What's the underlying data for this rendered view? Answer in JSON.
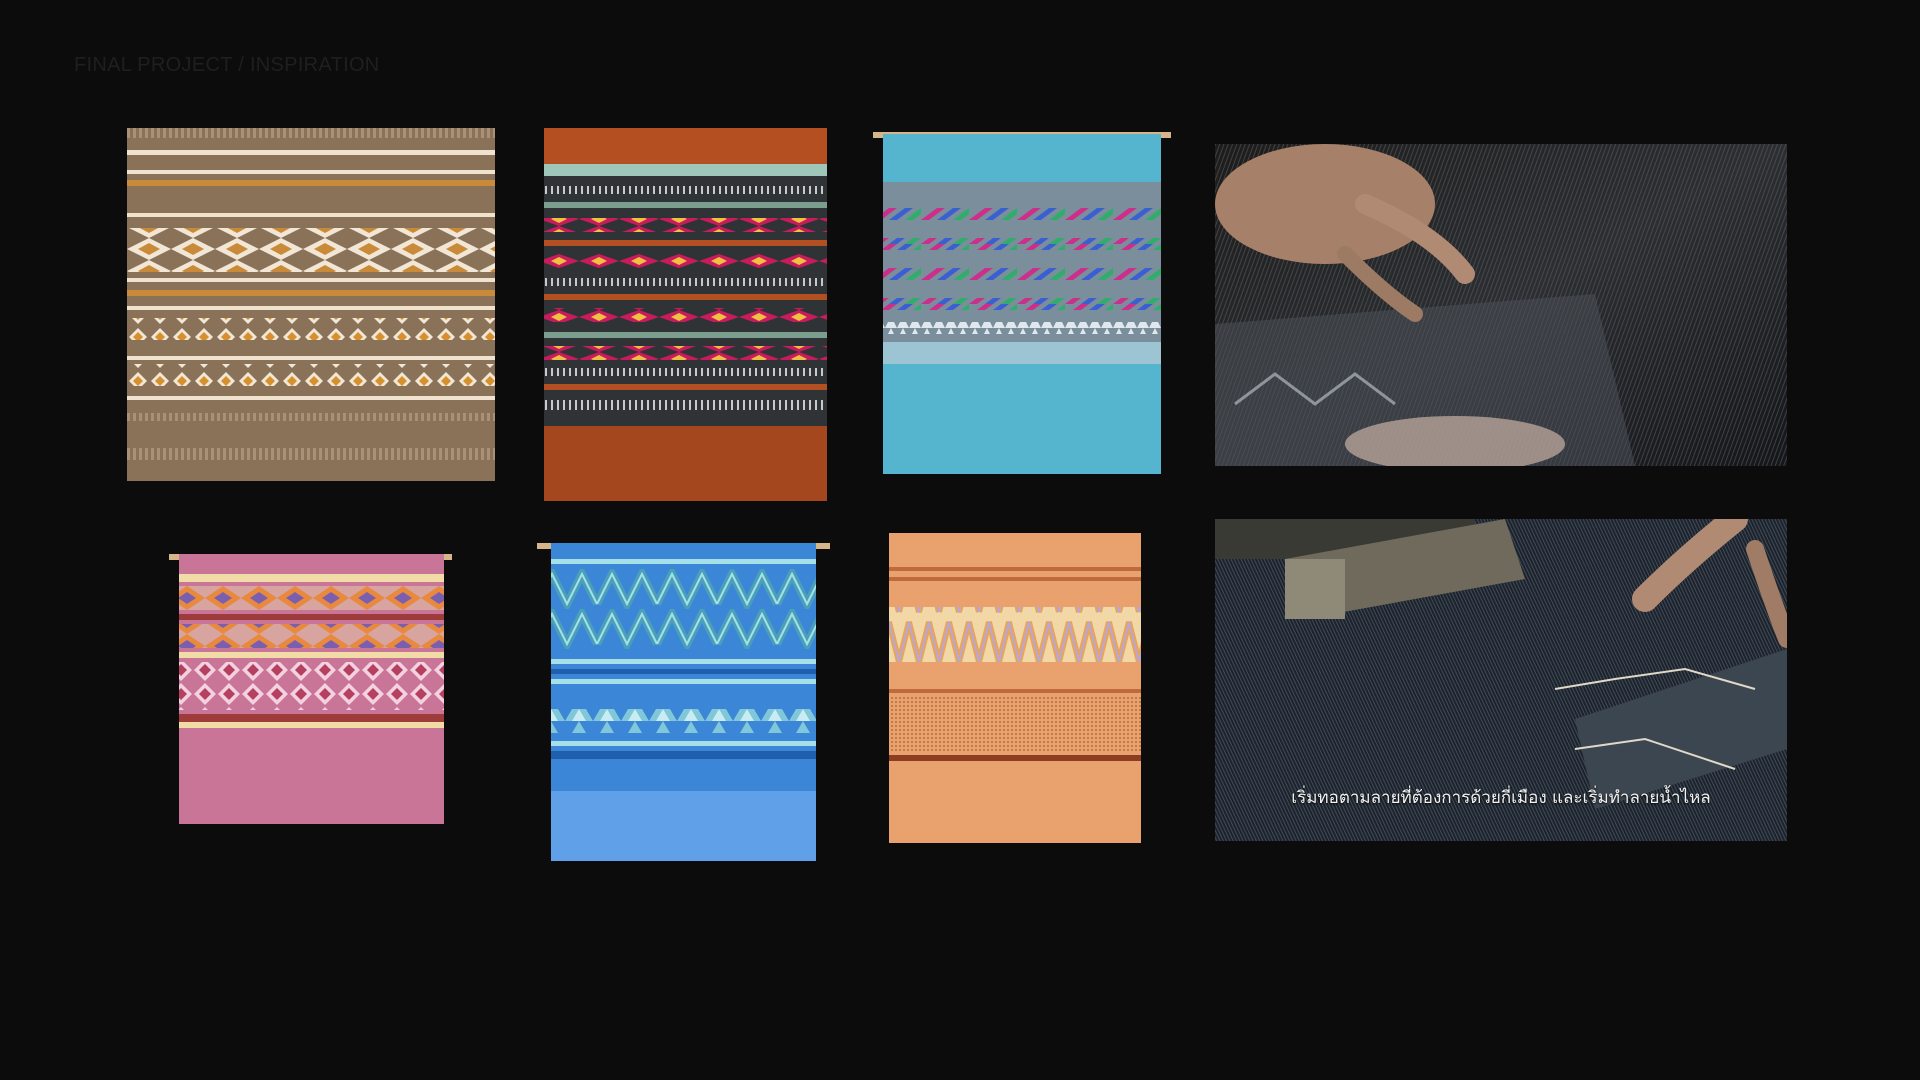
{
  "header": {
    "title": "FINAL PROJECT / INSPIRATION"
  },
  "gallery": {
    "images": [
      {
        "name": "textile-brown-geometric",
        "colors": {
          "base": "#8a7258",
          "pattern": "#f2e7d6",
          "accent": "#c98a3a"
        }
      },
      {
        "name": "textile-rust-dark-striped",
        "colors": {
          "base": "#a4471f",
          "pattern": "#2f3336",
          "accent": "#c81b5d"
        }
      },
      {
        "name": "textile-turquoise-striped",
        "colors": {
          "base": "#55b5cf",
          "pattern": "#7a8e9c",
          "accent": "#cc2f8a"
        }
      },
      {
        "name": "textile-pink-diamond",
        "colors": {
          "base": "#c97597",
          "pattern": "#e89a74",
          "accent": "#9e3c3c"
        }
      },
      {
        "name": "textile-blue-zigzag",
        "colors": {
          "base": "#3c86d8",
          "pattern": "#4aa0b8",
          "accent": "#a5e0e8"
        }
      },
      {
        "name": "textile-orange-ikat",
        "colors": {
          "base": "#e9a26e",
          "pattern": "#bf6a3c",
          "accent": "#f1d8a6"
        }
      }
    ],
    "videos": [
      {
        "name": "weaving-loom-closeup-1",
        "caption": ""
      },
      {
        "name": "weaving-loom-closeup-2",
        "caption": "เริ่มทอตามลายที่ต้องการด้วยกี่เมือง และเริ่มทำลายน้ำไหล"
      }
    ]
  }
}
